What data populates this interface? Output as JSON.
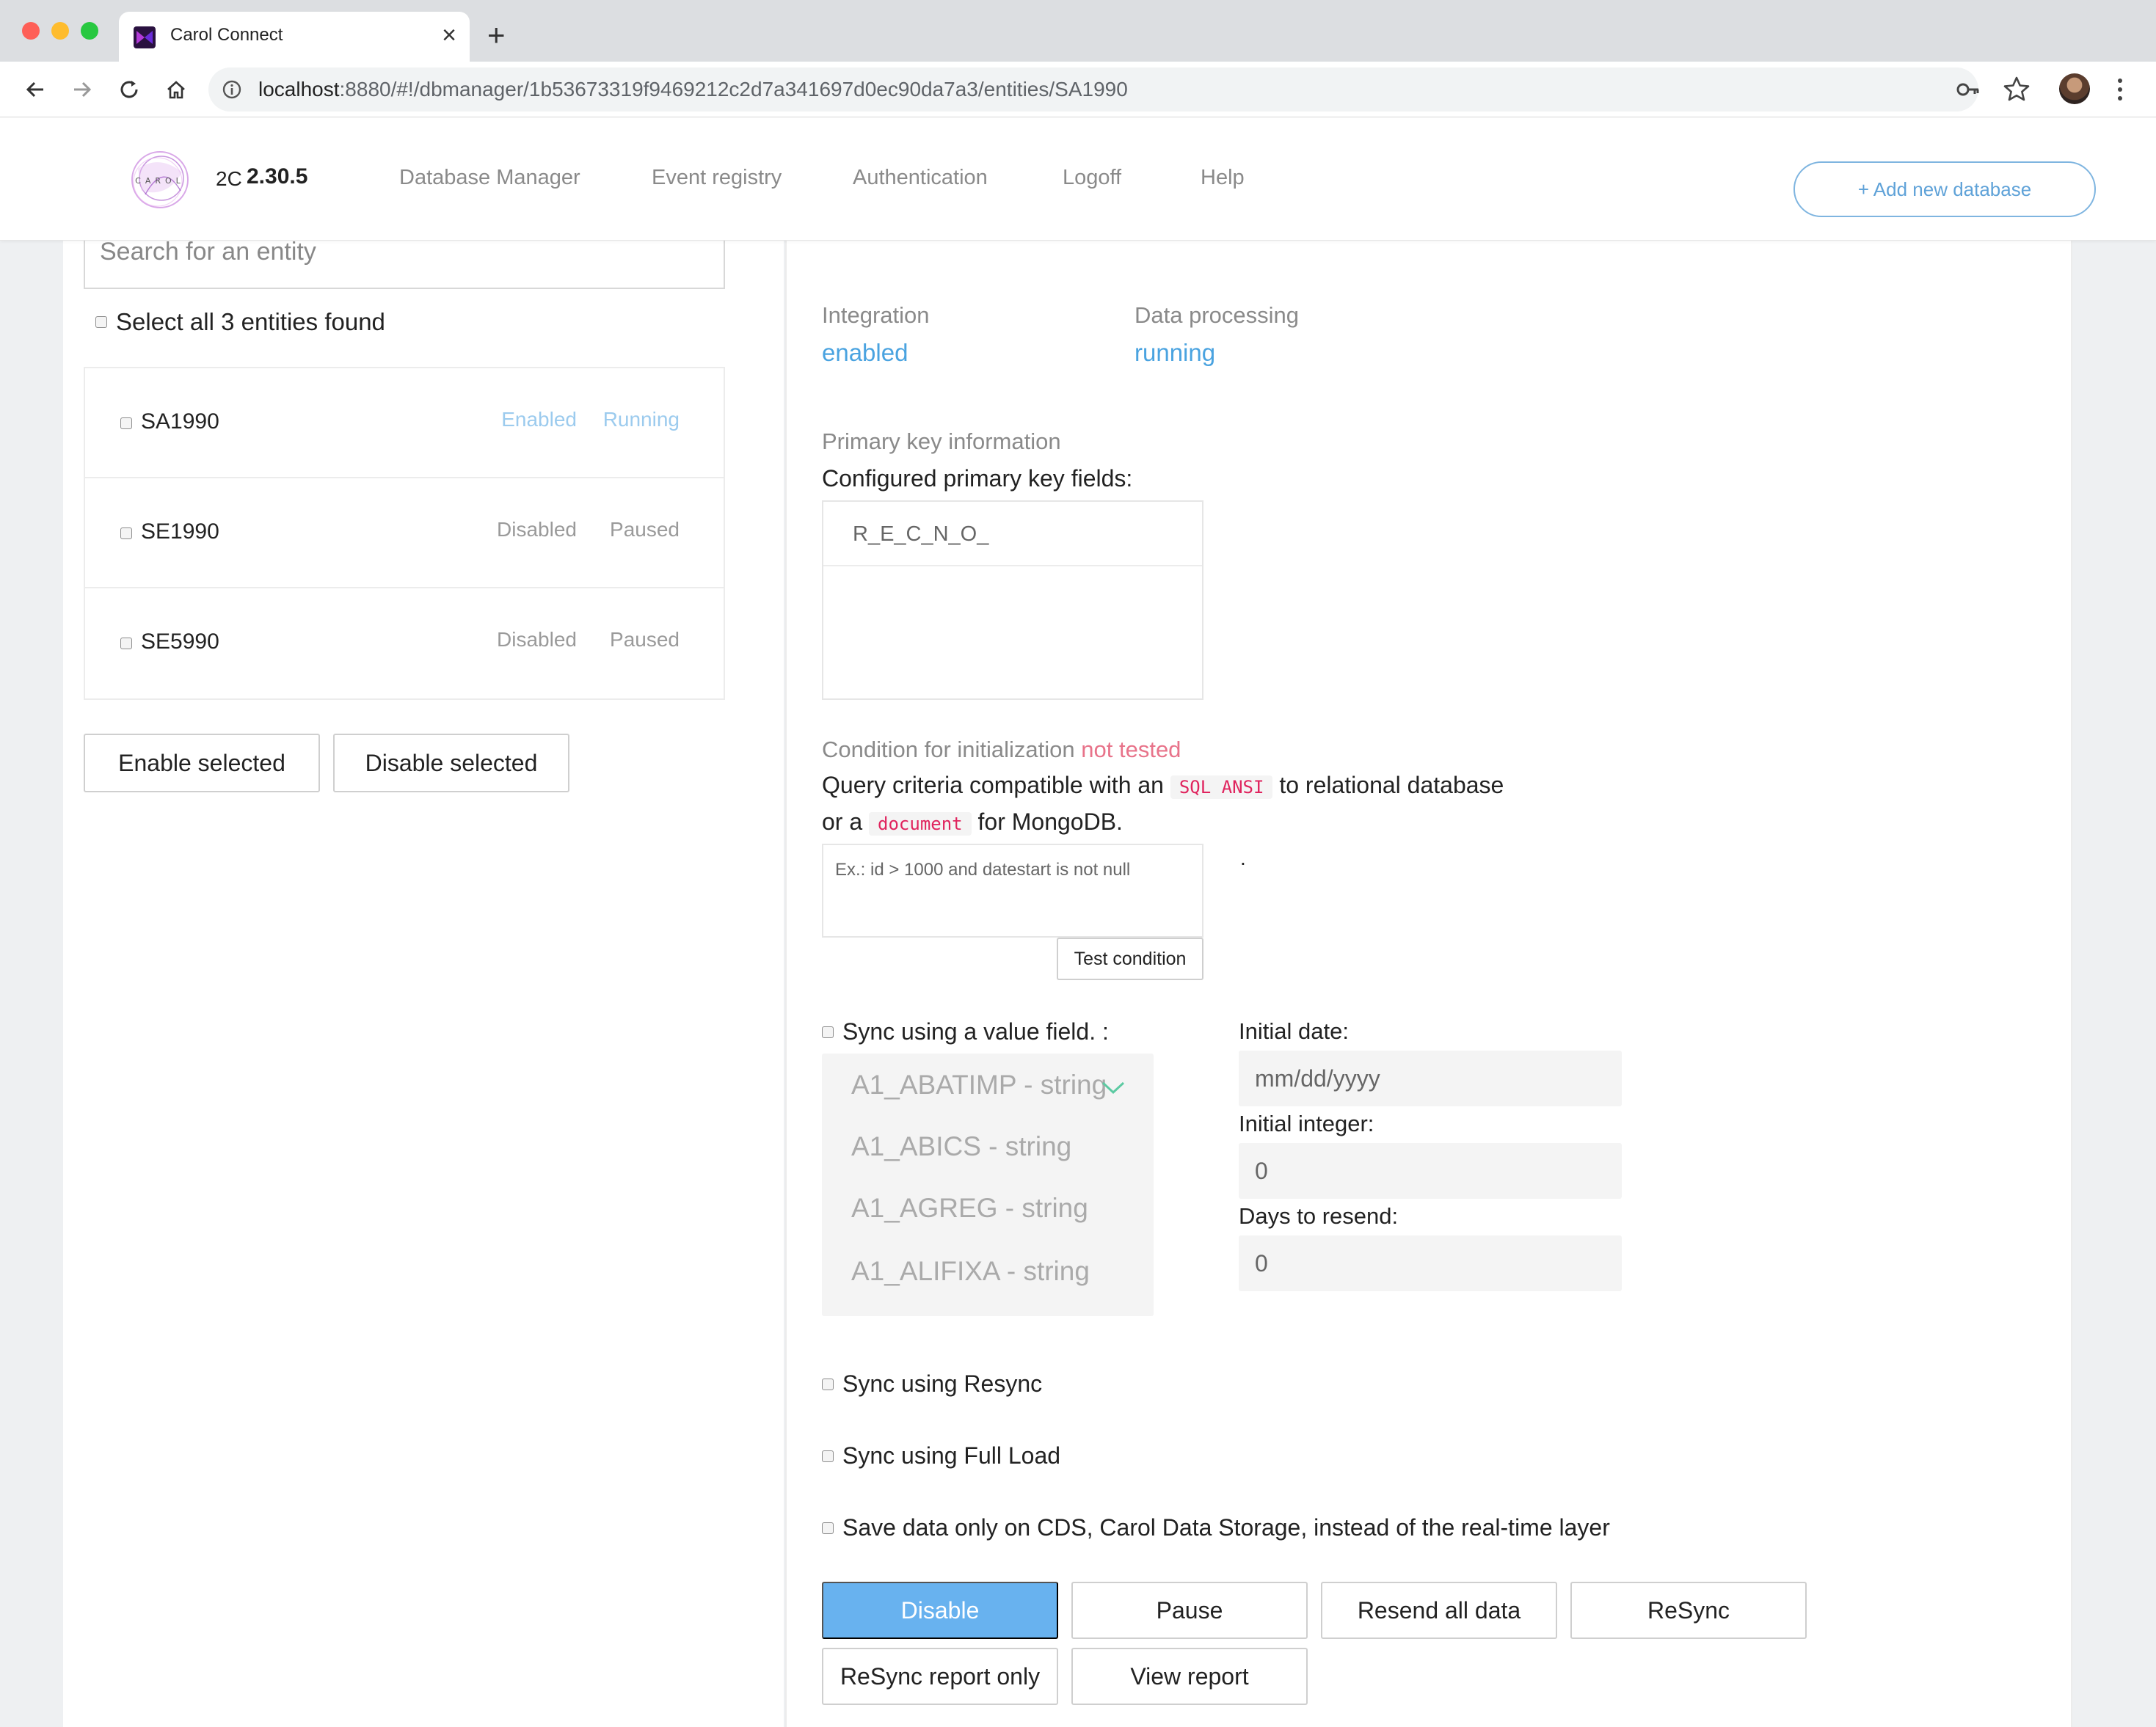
{
  "browser": {
    "tab_title": "Carol Connect",
    "url_host": "localhost",
    "url_rest": ":8880/#!/dbmanager/1b53673319f9469212c2d7a341697d0ec90da7a3/entities/SA1990"
  },
  "header": {
    "logo_text": "CAROL",
    "brand_mark": "2C",
    "version": "2.30.5",
    "nav": [
      "Database Manager",
      "Event registry",
      "Authentication",
      "Logoff",
      "Help"
    ],
    "add_database_label": "+ Add new database"
  },
  "left": {
    "search_placeholder": "Search for an entity",
    "select_all_label": "Select all 3 entities found",
    "entities": [
      {
        "name": "SA1990",
        "integration": "Enabled",
        "processing": "Running"
      },
      {
        "name": "SE1990",
        "integration": "Disabled",
        "processing": "Paused"
      },
      {
        "name": "SE5990",
        "integration": "Disabled",
        "processing": "Paused"
      }
    ],
    "enable_selected_label": "Enable selected",
    "disable_selected_label": "Disable selected"
  },
  "detail": {
    "integration_label": "Integration",
    "integration_value": "enabled",
    "processing_label": "Data processing",
    "processing_value": "running",
    "pk_section_label": "Primary key information",
    "pk_fields_label": "Configured primary key fields:",
    "pk_fields": [
      "R_E_C_N_O_"
    ],
    "condition_label": "Condition for initialization",
    "condition_status": "not tested",
    "query_text_1": "Query criteria compatible with an",
    "query_code_1": "SQL ANSI",
    "query_text_2": "to relational database",
    "query_text_3": "or a",
    "query_code_2": "document",
    "query_text_4": "for MongoDB.",
    "condition_placeholder": "Ex.: id > 1000 and datestart is not null",
    "dot": ".",
    "test_condition_label": "Test condition",
    "sync_value_label": "Sync using a value field. :",
    "value_fields": [
      "A1_ABATIMP - string",
      "A1_ABICS - string",
      "A1_AGREG - string",
      "A1_ALIFIXA - string"
    ],
    "initial_date_label": "Initial date:",
    "initial_date_placeholder": "mm/dd/yyyy",
    "initial_integer_label": "Initial integer:",
    "initial_integer_value": "0",
    "days_resend_label": "Days to resend:",
    "days_resend_value": "0",
    "sync_resync_label": "Sync using Resync",
    "sync_fullload_label": "Sync using Full Load",
    "save_cds_label": "Save data only on CDS, Carol Data Storage, instead of the real-time layer",
    "actions": {
      "disable": "Disable",
      "pause": "Pause",
      "resend_all": "Resend all data",
      "resync": "ReSync",
      "resync_report": "ReSync report only",
      "view_report": "View report"
    }
  },
  "colors": {
    "accent": "#4aa3e0",
    "primary_button": "#68b2ef",
    "warning_text": "#e8738a",
    "code_text": "#e0245e"
  }
}
